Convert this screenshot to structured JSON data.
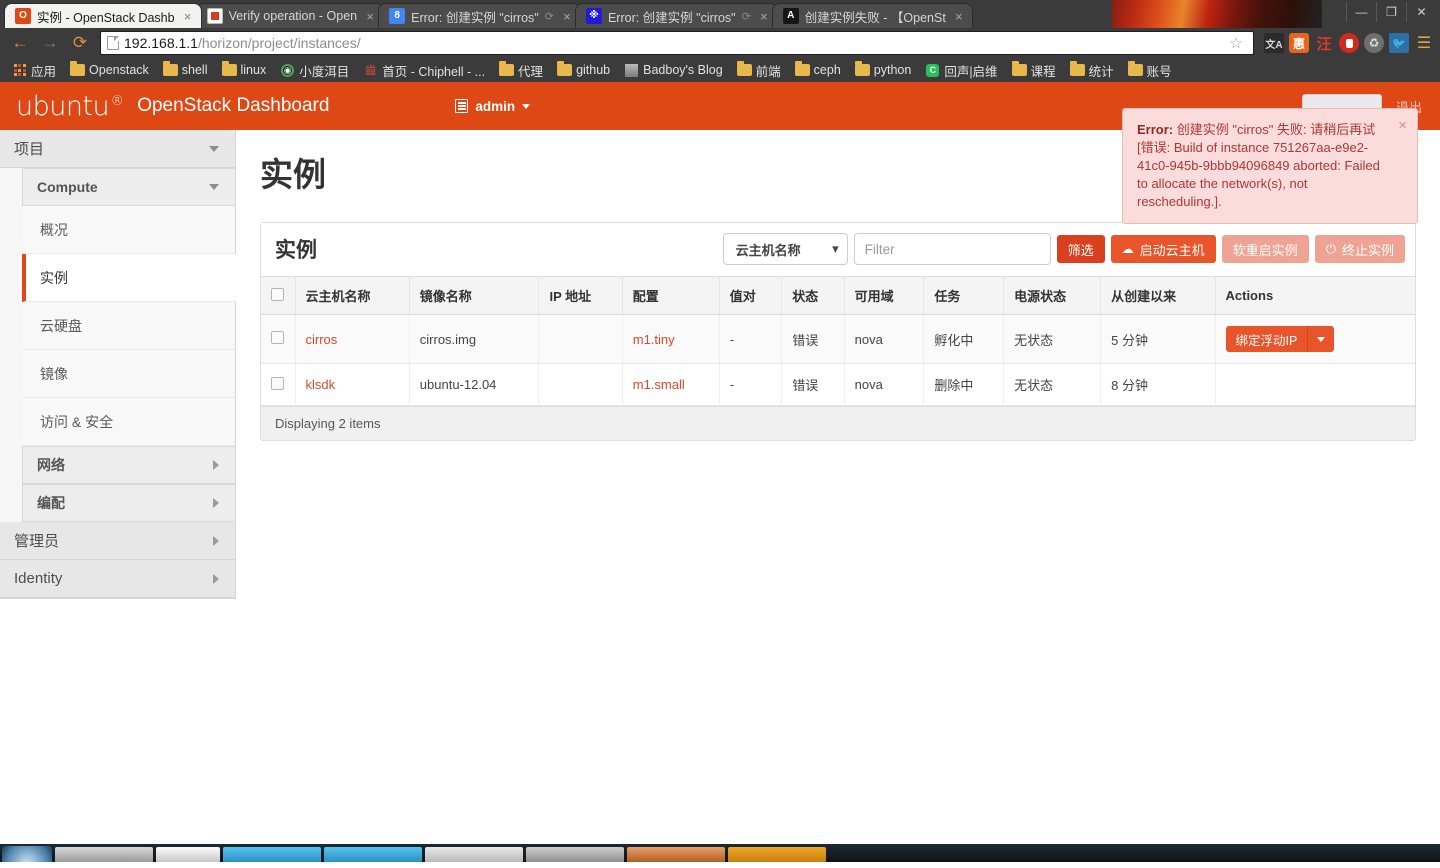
{
  "browser": {
    "tabs": [
      {
        "title": "实例 - OpenStack Dashb",
        "favicon": "openstack-icon",
        "active": true,
        "spinner": false
      },
      {
        "title": "Verify operation - Open",
        "favicon": "verify-icon",
        "active": false,
        "spinner": false
      },
      {
        "title": "Error: 创建实例 \"cirros\"",
        "favicon": "google-icon",
        "active": false,
        "spinner": true
      },
      {
        "title": "Error: 创建实例 \"cirros\"",
        "favicon": "baidu-icon",
        "active": false,
        "spinner": true
      },
      {
        "title": "创建实例失败 - 【OpenSt",
        "favicon": "generic-icon",
        "active": false,
        "spinner": false
      }
    ],
    "window_controls": {
      "minimize": "—",
      "maximize": "❐",
      "close": "✕"
    },
    "nav": {
      "back": "←",
      "forward": "→",
      "reload": "⟳"
    },
    "url": {
      "host": "192.168.1.1",
      "path": "/horizon/project/instances/"
    },
    "star": "☆",
    "extensions": [
      "translate-icon",
      "hui-icon",
      "wang-icon",
      "adblock-icon",
      "recycle-icon",
      "bird-icon"
    ],
    "menu": "☰",
    "bookmarks": [
      {
        "label": "应用",
        "icon": "apps-grid-icon"
      },
      {
        "label": "Openstack",
        "icon": "folder-icon"
      },
      {
        "label": "shell",
        "icon": "folder-icon"
      },
      {
        "label": "linux",
        "icon": "folder-icon"
      },
      {
        "label": "小度洱目",
        "icon": "headphone-icon"
      },
      {
        "label": "首页 - Chiphell - ...",
        "icon": "chiphell-icon"
      },
      {
        "label": "代理",
        "icon": "folder-icon"
      },
      {
        "label": "github",
        "icon": "folder-icon"
      },
      {
        "label": "Badboy's Blog",
        "icon": "photo-icon"
      },
      {
        "label": "前端",
        "icon": "folder-icon"
      },
      {
        "label": "ceph",
        "icon": "folder-icon"
      },
      {
        "label": "python",
        "icon": "folder-icon"
      },
      {
        "label": "回声|启维",
        "icon": "echo-icon"
      },
      {
        "label": "课程",
        "icon": "folder-icon"
      },
      {
        "label": "统计",
        "icon": "folder-icon"
      },
      {
        "label": "账号",
        "icon": "folder-icon"
      }
    ]
  },
  "header": {
    "logo": "ubuntu",
    "logo_sup": "®",
    "title": "OpenStack Dashboard",
    "user": "admin",
    "user_caret": "▾",
    "logout": "退出"
  },
  "sidebar": {
    "sections": [
      {
        "label": "项目",
        "type": "section",
        "caret": "down",
        "groups": [
          {
            "label": "Compute",
            "type": "group",
            "caret": "down",
            "items": [
              {
                "label": "概况",
                "active": false
              },
              {
                "label": "实例",
                "active": true
              },
              {
                "label": "云硬盘",
                "active": false
              },
              {
                "label": "镜像",
                "active": false
              },
              {
                "label": "访问 & 安全",
                "active": false
              }
            ]
          },
          {
            "label": "网络",
            "type": "group",
            "caret": "right",
            "items": []
          },
          {
            "label": "编配",
            "type": "group",
            "caret": "right",
            "items": []
          }
        ]
      },
      {
        "label": "管理员",
        "type": "section",
        "caret": "right",
        "groups": []
      },
      {
        "label": "Identity",
        "type": "section",
        "caret": "right",
        "groups": []
      }
    ]
  },
  "main": {
    "page_title": "实例",
    "panel_title": "实例",
    "filter": {
      "select_value": "云主机名称",
      "select_caret": "▾",
      "input_placeholder": "Filter",
      "input_value": ""
    },
    "buttons": {
      "filter": "筛选",
      "launch": "启动云主机",
      "soft_reboot": "软重启实例",
      "terminate": "终止实例"
    },
    "table": {
      "columns": [
        "云主机名称",
        "镜像名称",
        "IP 地址",
        "配置",
        "值对",
        "状态",
        "可用域",
        "任务",
        "电源状态",
        "从创建以来",
        "Actions"
      ],
      "rows": [
        {
          "name": "cirros",
          "image": "cirros.img",
          "ip": "",
          "flavor": "m1.tiny",
          "keypair": "-",
          "status": "错误",
          "zone": "nova",
          "task": "孵化中",
          "power": "无状态",
          "uptime": "5 分钟",
          "action": "绑定浮动IP",
          "has_action": true
        },
        {
          "name": "klsdk",
          "image": "ubuntu-12.04",
          "ip": "",
          "flavor": "m1.small",
          "keypair": "-",
          "status": "错误",
          "zone": "nova",
          "task": "删除中",
          "power": "无状态",
          "uptime": "8 分钟",
          "action": "",
          "has_action": false
        }
      ],
      "footer": "Displaying 2 items"
    }
  },
  "alert": {
    "prefix": "Error:",
    "message": " 创建实例 \"cirros\" 失败: 请稍后再试 [错误: Build of instance 751267aa-e9e2-41c0-945b-9bbb94096849 aborted: Failed to allocate the network(s), not rescheduling.].",
    "close": "×"
  },
  "colors": {
    "brand_orange": "#dd4814",
    "button_orange": "#e8552b",
    "filter_red": "#d9401f",
    "link_red": "#d9472b",
    "alert_bg": "#fbdcdc",
    "alert_text": "#b03733"
  }
}
